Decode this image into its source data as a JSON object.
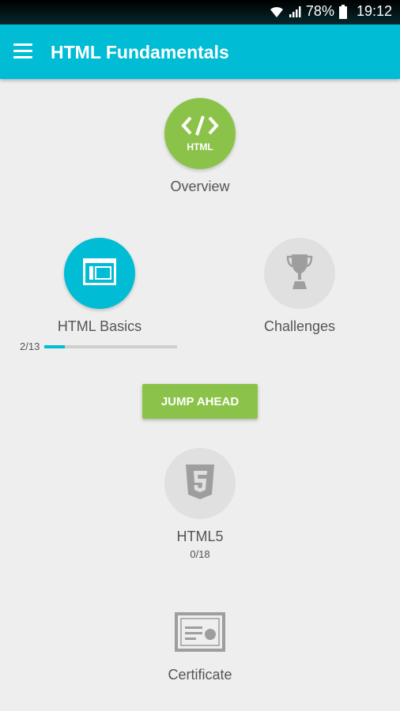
{
  "status_bar": {
    "battery": "78%",
    "time": "19:12",
    "icons": [
      "wifi-icon",
      "signal-icon",
      "battery-icon"
    ]
  },
  "app_bar": {
    "title": "HTML Fundamentals",
    "menu_icon": "menu-icon"
  },
  "modules": {
    "overview": {
      "label": "Overview",
      "icon": "html-code-icon",
      "icon_text": "HTML"
    },
    "html_basics": {
      "label": "HTML Basics",
      "icon": "layout-icon",
      "progress_text": "2/13",
      "progress_fraction": 0.1538
    },
    "challenges": {
      "label": "Challenges",
      "icon": "trophy-icon"
    },
    "html5": {
      "label": "HTML5",
      "icon": "html5-shield-icon",
      "progress_text": "0/18"
    },
    "certificate": {
      "label": "Certificate",
      "icon": "certificate-icon"
    }
  },
  "jump_ahead": {
    "label": "JUMP AHEAD"
  },
  "colors": {
    "primary": "#00bcd4",
    "accent_green": "#8bc34a",
    "locked_grey": "#e0e0e0",
    "background": "#eeeeee"
  }
}
